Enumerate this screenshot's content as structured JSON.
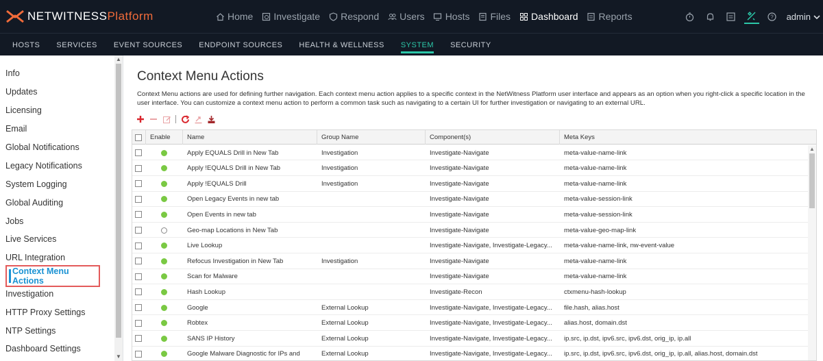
{
  "brand": {
    "name": "NETWITNESS",
    "suffix": "Platform",
    "accent": "#f06b3a",
    "highlight": "#2cc7a8"
  },
  "main_nav": [
    {
      "label": "Home",
      "icon": "home-icon",
      "active": false
    },
    {
      "label": "Investigate",
      "icon": "investigate-icon",
      "active": false
    },
    {
      "label": "Respond",
      "icon": "respond-icon",
      "active": false
    },
    {
      "label": "Users",
      "icon": "users-icon",
      "active": false
    },
    {
      "label": "Hosts",
      "icon": "hosts-icon",
      "active": false
    },
    {
      "label": "Files",
      "icon": "files-icon",
      "active": false
    },
    {
      "label": "Dashboard",
      "icon": "dashboard-icon",
      "active": true
    },
    {
      "label": "Reports",
      "icon": "reports-icon",
      "active": false
    }
  ],
  "user": {
    "name": "admin"
  },
  "sub_nav": [
    {
      "label": "HOSTS",
      "active": false
    },
    {
      "label": "SERVICES",
      "active": false
    },
    {
      "label": "EVENT SOURCES",
      "active": false
    },
    {
      "label": "ENDPOINT SOURCES",
      "active": false
    },
    {
      "label": "HEALTH & WELLNESS",
      "active": false
    },
    {
      "label": "SYSTEM",
      "active": true
    },
    {
      "label": "SECURITY",
      "active": false
    }
  ],
  "sidebar": {
    "items": [
      {
        "label": "Info"
      },
      {
        "label": "Updates"
      },
      {
        "label": "Licensing"
      },
      {
        "label": "Email"
      },
      {
        "label": "Global Notifications"
      },
      {
        "label": "Legacy Notifications"
      },
      {
        "label": "System Logging"
      },
      {
        "label": "Global Auditing"
      },
      {
        "label": "Jobs"
      },
      {
        "label": "Live Services"
      },
      {
        "label": "URL Integration"
      },
      {
        "label": "Context Menu Actions",
        "active": true
      },
      {
        "label": "Investigation"
      },
      {
        "label": "HTTP Proxy Settings"
      },
      {
        "label": "NTP Settings"
      },
      {
        "label": "Dashboard Settings"
      }
    ]
  },
  "page": {
    "title": "Context Menu Actions",
    "description": "Context Menu actions are used for defining further navigation. Each context menu action applies to a specific context in the NetWitness Platform user interface and appears as an option when you right-click a specific location in the user interface. You can customize a context menu action to perform a common task such as navigating to a certain UI for further investigation or navigating to an external URL."
  },
  "table": {
    "columns": [
      "Enable",
      "Name",
      "Group Name",
      "Component(s)",
      "Meta Keys"
    ],
    "rows": [
      {
        "enabled": true,
        "name": "Apply EQUALS Drill in New Tab",
        "group": "Investigation",
        "components": "Investigate-Navigate",
        "meta": "meta-value-name-link"
      },
      {
        "enabled": true,
        "name": "Apply !EQUALS Drill in New Tab",
        "group": "Investigation",
        "components": "Investigate-Navigate",
        "meta": "meta-value-name-link"
      },
      {
        "enabled": true,
        "name": "Apply !EQUALS Drill",
        "group": "Investigation",
        "components": "Investigate-Navigate",
        "meta": "meta-value-name-link"
      },
      {
        "enabled": true,
        "name": "Open Legacy Events in new tab",
        "group": "",
        "components": "Investigate-Navigate",
        "meta": "meta-value-session-link"
      },
      {
        "enabled": true,
        "name": "Open Events in new tab",
        "group": "",
        "components": "Investigate-Navigate",
        "meta": "meta-value-session-link"
      },
      {
        "enabled": false,
        "name": "Geo-map Locations in New Tab",
        "group": "",
        "components": "Investigate-Navigate",
        "meta": "meta-value-geo-map-link"
      },
      {
        "enabled": true,
        "name": "Live Lookup",
        "group": "",
        "components": "Investigate-Navigate, Investigate-Legacy...",
        "meta": "meta-value-name-link, nw-event-value"
      },
      {
        "enabled": true,
        "name": "Refocus Investigation in New Tab",
        "group": "Investigation",
        "components": "Investigate-Navigate",
        "meta": "meta-value-name-link"
      },
      {
        "enabled": true,
        "name": "Scan for Malware",
        "group": "",
        "components": "Investigate-Navigate",
        "meta": "meta-value-name-link"
      },
      {
        "enabled": true,
        "name": "Hash Lookup",
        "group": "",
        "components": "Investigate-Recon",
        "meta": "ctxmenu-hash-lookup"
      },
      {
        "enabled": true,
        "name": "Google",
        "group": "External Lookup",
        "components": "Investigate-Navigate, Investigate-Legacy...",
        "meta": "file.hash, alias.host"
      },
      {
        "enabled": true,
        "name": "Robtex",
        "group": "External Lookup",
        "components": "Investigate-Navigate, Investigate-Legacy...",
        "meta": "alias.host, domain.dst"
      },
      {
        "enabled": true,
        "name": "SANS IP History",
        "group": "External Lookup",
        "components": "Investigate-Navigate, Investigate-Legacy...",
        "meta": "ip.src, ip.dst, ipv6.src, ipv6.dst, orig_ip, ip.all"
      },
      {
        "enabled": true,
        "name": "Google Malware Diagnostic for IPs and",
        "group": "External Lookup",
        "components": "Investigate-Navigate, Investigate-Legacy...",
        "meta": "ip.src, ip.dst, ipv6.src, ipv6.dst, orig_ip, ip.all, alias.host, domain.dst"
      }
    ]
  }
}
